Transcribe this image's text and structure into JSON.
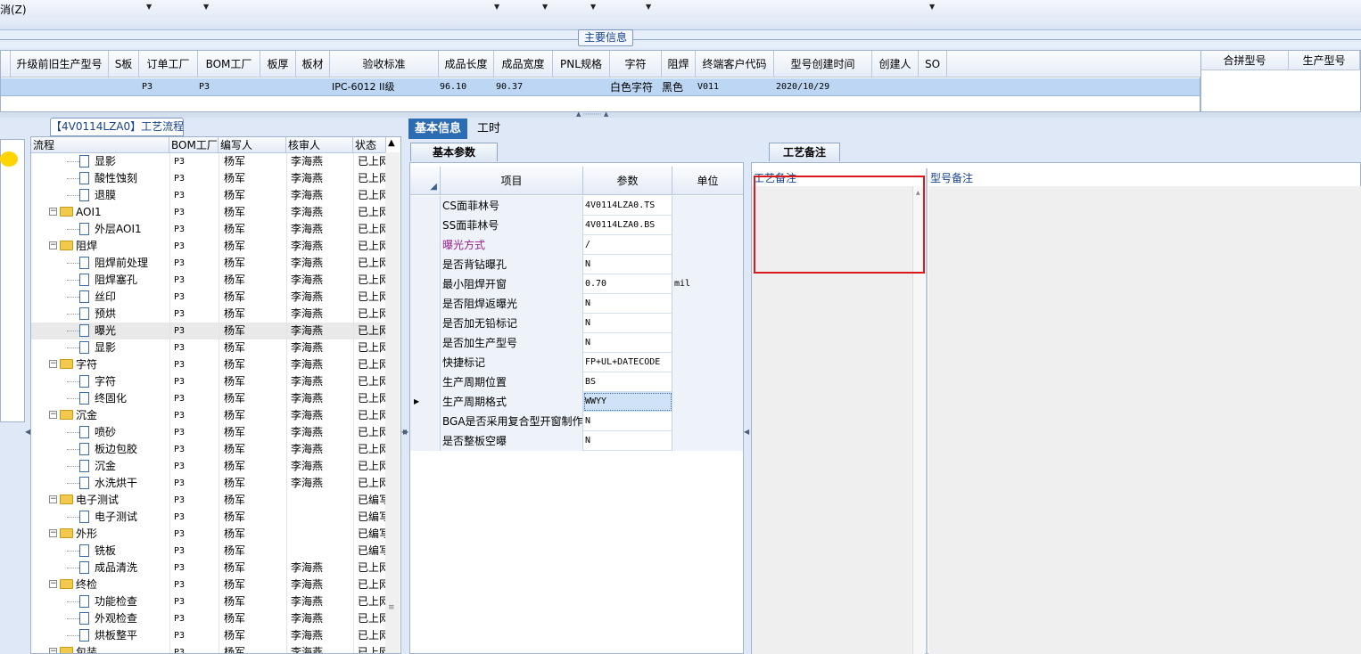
{
  "toolbar": {
    "cancel_label": "消(Z)"
  },
  "main_info_tab": "主要信息",
  "top_grid": {
    "headers": [
      "升级前旧生产型号",
      "S板",
      "订单工厂",
      "BOM工厂",
      "板厚",
      "板材",
      "验收标准",
      "成品长度",
      "成品宽度",
      "PNL规格",
      "字符",
      "阻焊",
      "终端客户代码",
      "型号创建时间",
      "创建人",
      "SO"
    ],
    "row": {
      "order_factory": "P3",
      "bom_factory": "P3",
      "acceptance": "IPC-6012 II级",
      "length": "96.10",
      "width": "90.37",
      "char": "白色字符",
      "solder": "黑色",
      "customer": "V011",
      "created": "2020/10/29"
    },
    "right_headers": [
      "合拼型号",
      "生产型号"
    ]
  },
  "flow_panel": {
    "title": "【4V0114LZA0】工艺流程",
    "headers": [
      "流程",
      "BOM工厂",
      "编写人",
      "核审人",
      "状态"
    ],
    "rows": [
      {
        "name": "显影",
        "level": 2,
        "type": "doc",
        "bom": "P3",
        "writer": "杨军",
        "reviewer": "李海燕",
        "status": "已上网"
      },
      {
        "name": "酸性蚀刻",
        "level": 2,
        "type": "doc",
        "bom": "P3",
        "writer": "杨军",
        "reviewer": "李海燕",
        "status": "已上网"
      },
      {
        "name": "退膜",
        "level": 2,
        "type": "doc",
        "bom": "P3",
        "writer": "杨军",
        "reviewer": "李海燕",
        "status": "已上网"
      },
      {
        "name": "AOI1",
        "level": 1,
        "type": "folder",
        "bom": "P3",
        "writer": "杨军",
        "reviewer": "李海燕",
        "status": "已上网"
      },
      {
        "name": "外层AOI1",
        "level": 2,
        "type": "doc",
        "bom": "P3",
        "writer": "杨军",
        "reviewer": "李海燕",
        "status": "已上网"
      },
      {
        "name": "阻焊",
        "level": 1,
        "type": "folder",
        "bom": "P3",
        "writer": "杨军",
        "reviewer": "李海燕",
        "status": "已上网"
      },
      {
        "name": "阻焊前处理",
        "level": 2,
        "type": "doc",
        "bom": "P3",
        "writer": "杨军",
        "reviewer": "李海燕",
        "status": "已上网"
      },
      {
        "name": "阻焊塞孔",
        "level": 2,
        "type": "doc",
        "bom": "P3",
        "writer": "杨军",
        "reviewer": "李海燕",
        "status": "已上网"
      },
      {
        "name": "丝印",
        "level": 2,
        "type": "doc",
        "bom": "P3",
        "writer": "杨军",
        "reviewer": "李海燕",
        "status": "已上网"
      },
      {
        "name": "预烘",
        "level": 2,
        "type": "doc",
        "bom": "P3",
        "writer": "杨军",
        "reviewer": "李海燕",
        "status": "已上网"
      },
      {
        "name": "曝光",
        "level": 2,
        "type": "doc",
        "bom": "P3",
        "writer": "杨军",
        "reviewer": "李海燕",
        "status": "已上网",
        "selected": true
      },
      {
        "name": "显影",
        "level": 2,
        "type": "doc",
        "bom": "P3",
        "writer": "杨军",
        "reviewer": "李海燕",
        "status": "已上网"
      },
      {
        "name": "字符",
        "level": 1,
        "type": "folder",
        "bom": "P3",
        "writer": "杨军",
        "reviewer": "李海燕",
        "status": "已上网"
      },
      {
        "name": "字符",
        "level": 2,
        "type": "doc",
        "bom": "P3",
        "writer": "杨军",
        "reviewer": "李海燕",
        "status": "已上网"
      },
      {
        "name": "终固化",
        "level": 2,
        "type": "doc",
        "bom": "P3",
        "writer": "杨军",
        "reviewer": "李海燕",
        "status": "已上网"
      },
      {
        "name": "沉金",
        "level": 1,
        "type": "folder",
        "bom": "P3",
        "writer": "杨军",
        "reviewer": "李海燕",
        "status": "已上网"
      },
      {
        "name": "喷砂",
        "level": 2,
        "type": "doc",
        "bom": "P3",
        "writer": "杨军",
        "reviewer": "李海燕",
        "status": "已上网"
      },
      {
        "name": "板边包胶",
        "level": 2,
        "type": "doc",
        "bom": "P3",
        "writer": "杨军",
        "reviewer": "李海燕",
        "status": "已上网"
      },
      {
        "name": "沉金",
        "level": 2,
        "type": "doc",
        "bom": "P3",
        "writer": "杨军",
        "reviewer": "李海燕",
        "status": "已上网"
      },
      {
        "name": "水洗烘干",
        "level": 2,
        "type": "doc",
        "bom": "P3",
        "writer": "杨军",
        "reviewer": "李海燕",
        "status": "已上网"
      },
      {
        "name": "电子测试",
        "level": 1,
        "type": "folder",
        "bom": "P3",
        "writer": "杨军",
        "reviewer": "",
        "status": "已编写"
      },
      {
        "name": "电子测试",
        "level": 2,
        "type": "doc",
        "bom": "P3",
        "writer": "杨军",
        "reviewer": "",
        "status": "已编写"
      },
      {
        "name": "外形",
        "level": 1,
        "type": "folder",
        "bom": "P3",
        "writer": "杨军",
        "reviewer": "",
        "status": "已编写"
      },
      {
        "name": "铣板",
        "level": 2,
        "type": "doc",
        "bom": "P3",
        "writer": "杨军",
        "reviewer": "",
        "status": "已编写"
      },
      {
        "name": "成品清洗",
        "level": 2,
        "type": "doc",
        "bom": "P3",
        "writer": "杨军",
        "reviewer": "李海燕",
        "status": "已上网"
      },
      {
        "name": "终检",
        "level": 1,
        "type": "folder",
        "bom": "P3",
        "writer": "杨军",
        "reviewer": "李海燕",
        "status": "已上网"
      },
      {
        "name": "功能检查",
        "level": 2,
        "type": "doc",
        "bom": "P3",
        "writer": "杨军",
        "reviewer": "李海燕",
        "status": "已上网"
      },
      {
        "name": "外观检查",
        "level": 2,
        "type": "doc",
        "bom": "P3",
        "writer": "杨军",
        "reviewer": "李海燕",
        "status": "已上网"
      },
      {
        "name": "烘板整平",
        "level": 2,
        "type": "doc",
        "bom": "P3",
        "writer": "杨军",
        "reviewer": "李海燕",
        "status": "已上网"
      },
      {
        "name": "包装",
        "level": 1,
        "type": "folder",
        "bom": "P3",
        "writer": "杨军",
        "reviewer": "李海燕",
        "status": "已上网"
      }
    ]
  },
  "tabs": {
    "basic": "基本信息",
    "hours": "工时"
  },
  "basic_params": {
    "title": "基本参数",
    "headers": [
      "项目",
      "参数",
      "单位"
    ],
    "rows": [
      {
        "item": "CS面菲林号",
        "value": "4V0114LZA0.TS",
        "unit": ""
      },
      {
        "item": "SS面菲林号",
        "value": "4V0114LZA0.BS",
        "unit": ""
      },
      {
        "item": "曝光方式",
        "value": "/",
        "unit": "",
        "highlight": true
      },
      {
        "item": "是否背钻曝孔",
        "value": "N",
        "unit": ""
      },
      {
        "item": "最小阻焊开窗",
        "value": "0.70",
        "unit": "mil"
      },
      {
        "item": "是否阻焊返曝光",
        "value": "N",
        "unit": ""
      },
      {
        "item": "是否加无铅标记",
        "value": "N",
        "unit": ""
      },
      {
        "item": "是否加生产型号",
        "value": "N",
        "unit": ""
      },
      {
        "item": "快捷标记",
        "value": "FP+UL+DATECODE",
        "unit": ""
      },
      {
        "item": "生产周期位置",
        "value": "BS",
        "unit": ""
      },
      {
        "item": "生产周期格式",
        "value": "WWYY",
        "unit": "",
        "current": true
      },
      {
        "item": "BGA是否采用复合型开窗制作",
        "value": "N",
        "unit": ""
      },
      {
        "item": "是否整板空曝",
        "value": "N",
        "unit": ""
      }
    ]
  },
  "notes": {
    "tab": "工艺备注",
    "process_note_label": "工艺备注",
    "model_note_label": "型号备注"
  },
  "colors": {
    "accent": "#2b6cb3",
    "selected_row": "#bcd6f3",
    "highlight_text": "#9b1c8f",
    "red_box": "#d9191c"
  }
}
